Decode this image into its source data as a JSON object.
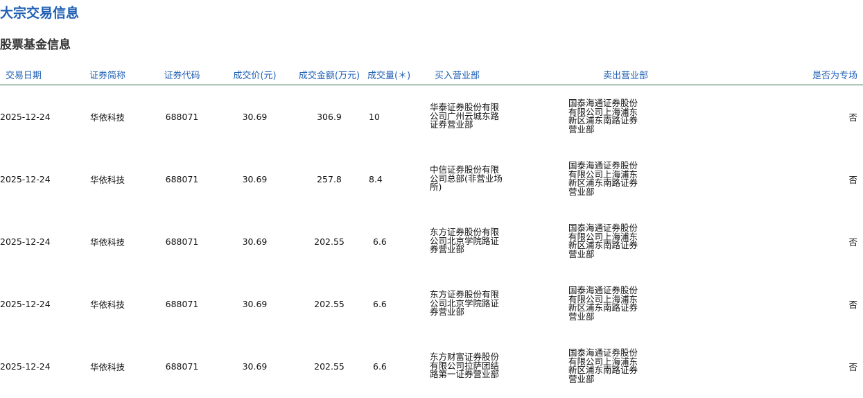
{
  "page": {
    "title": "大宗交易信息",
    "section_title": "股票基金信息"
  },
  "table": {
    "headers": [
      "交易日期",
      "证券简称",
      "证券代码",
      "成交价(元)",
      "成交金额(万元)",
      "成交量(＊)",
      "买入营业部",
      "卖出营业部",
      "是否为专场"
    ],
    "rows": [
      {
        "date": "2025-12-24",
        "name": "华依科技",
        "code": "688071",
        "price": "30.69",
        "amount": "306.9",
        "volume": "10",
        "buyer": "华泰证券股份有限公司广州云城东路证券营业部",
        "seller": "国泰海通证券股份有限公司上海浦东新区浦东南路证券营业部",
        "special": "否"
      },
      {
        "date": "2025-12-24",
        "name": "华依科技",
        "code": "688071",
        "price": "30.69",
        "amount": "257.8",
        "volume": "8.4",
        "buyer": "中信证券股份有限公司总部(非营业场所)",
        "seller": "国泰海通证券股份有限公司上海浦东新区浦东南路证券营业部",
        "special": "否"
      },
      {
        "date": "2025-12-24",
        "name": "华依科技",
        "code": "688071",
        "price": "30.69",
        "amount": "202.55",
        "volume": "6.6",
        "buyer": "东方证券股份有限公司北京学院路证券营业部",
        "seller": "国泰海通证券股份有限公司上海浦东新区浦东南路证券营业部",
        "special": "否"
      },
      {
        "date": "2025-12-24",
        "name": "华依科技",
        "code": "688071",
        "price": "30.69",
        "amount": "202.55",
        "volume": "6.6",
        "buyer": "东方证券股份有限公司北京学院路证券营业部",
        "seller": "国泰海通证券股份有限公司上海浦东新区浦东南路证券营业部",
        "special": "否"
      },
      {
        "date": "2025-12-24",
        "name": "华依科技",
        "code": "688071",
        "price": "30.69",
        "amount": "202.55",
        "volume": "6.6",
        "buyer": "东方财富证券股份有限公司拉萨团结路第一证券营业部",
        "seller": "国泰海通证券股份有限公司上海浦东新区浦东南路证券营业部",
        "special": "否"
      }
    ]
  },
  "colors": {
    "title": "#1f5fb4",
    "header_text": "#1f5fb4",
    "header_rule": "#2d6b3f",
    "section_title": "#333333"
  }
}
